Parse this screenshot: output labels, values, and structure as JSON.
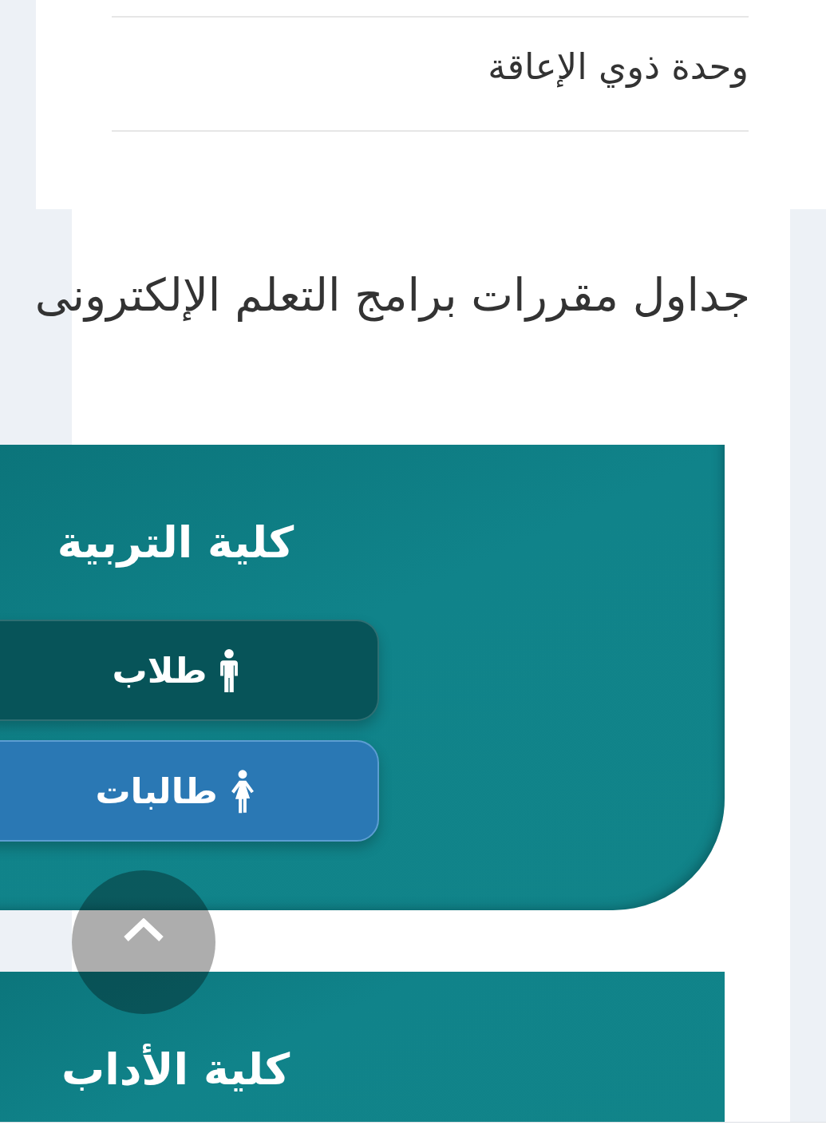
{
  "top_menu": {
    "items": [
      {
        "label": "وحدة ذوي الإعاقة"
      }
    ]
  },
  "page_title": "جداول مقررات برامج التعلم الإلكترونى",
  "colleges": [
    {
      "name": "كلية التربية",
      "buttons": [
        {
          "kind": "male",
          "label": "طلاب"
        },
        {
          "kind": "female",
          "label": "طالبات"
        }
      ]
    },
    {
      "name": "كلية الأداب"
    }
  ]
}
